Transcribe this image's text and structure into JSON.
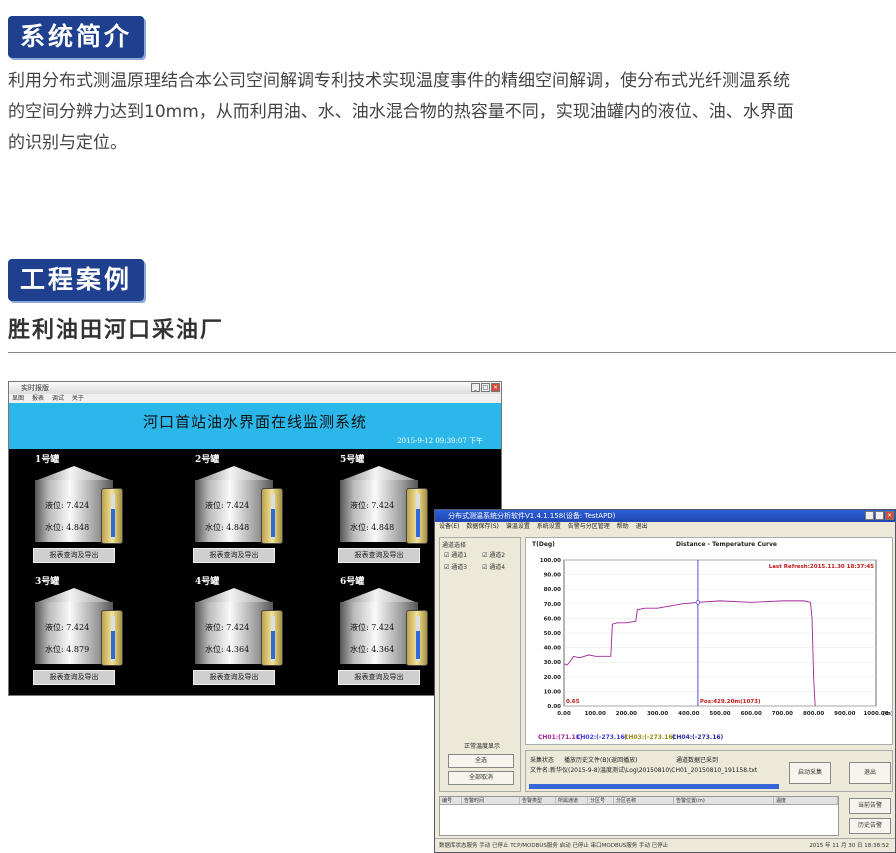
{
  "intro": {
    "badge": "系统简介",
    "text": "利用分布式测温原理结合本公司空间解调专利技术实现温度事件的精细空间解调，使分布式光纤测温系统\n的空间分辨力达到10mm，从而利用油、水、油水混合物的热容量不同，实现油罐内的液位、油、水界面\n的识别与定位。"
  },
  "cases": {
    "badge": "工程案例",
    "subtitle": "胜利油田河口采油厂"
  },
  "monitor_window": {
    "title_bar": "实时报版",
    "menu": [
      "显图",
      "报表",
      "调试",
      "关于"
    ],
    "header_title": "河口首站油水界面在线监测系统",
    "datetime": "2015-9-12  09:39:07 下午",
    "tanks": [
      {
        "name": "1号罐",
        "level_label": "液位",
        "level": "7.424",
        "water_label": "水位",
        "water": "4.848",
        "button": "报表查询及导出"
      },
      {
        "name": "2号罐",
        "level_label": "液位",
        "level": "7.424",
        "water_label": "水位",
        "water": "4.848",
        "button": "报表查询及导出"
      },
      {
        "name": "5号罐",
        "level_label": "液位",
        "level": "7.424",
        "water_label": "水位",
        "water": "4.848",
        "button": "报表查询及导出"
      },
      {
        "name": "3号罐",
        "level_label": "液位",
        "level": "7.424",
        "water_label": "水位",
        "water": "4.879",
        "button": "报表查询及导出"
      },
      {
        "name": "4号罐",
        "level_label": "液位",
        "level": "7.424",
        "water_label": "水位",
        "water": "4.364",
        "button": "报表查询及导出"
      },
      {
        "name": "6号罐",
        "level_label": "液位",
        "level": "7.424",
        "water_label": "水位",
        "water": "4.364",
        "button": "报表查询及导出"
      }
    ]
  },
  "analysis_window": {
    "title_bar": "分布式测温系统分析软件V1.4.1.158(设备: TestAPD)",
    "menu": [
      "设备(E)",
      "数据保存(S)",
      "谱温设置",
      "系统设置",
      "告警与分区管理",
      "帮助",
      "退出"
    ],
    "channel_group": "通道选择",
    "channels": [
      "通道1",
      "通道2",
      "通道3",
      "通道4"
    ],
    "buttons": [
      "正常温度显示",
      "全选",
      "全部取消"
    ],
    "status_labels": [
      "采集状态",
      "播放历史文件(B)(返回播放)",
      "通道数据已采到"
    ],
    "file_label": "文件名:新华仪(2015-9-8)温度测试\\Log\\20150810\\CH01_20150810_191158.txt",
    "start_button": "启动采集",
    "exit_button": "退出",
    "table_headers": [
      "编号",
      "告警时间",
      "告警类型",
      "所属通道",
      "分区号",
      "分区名称",
      "告警位置(m)",
      "温度"
    ],
    "side_buttons": [
      "当前告警",
      "历史告警"
    ],
    "status_bar": "数据库状态服务  手动  已停止    TCP/MODBUS服务  启动  已停止    串口MODBUS服务  手动  已停止",
    "status_time": "2015 年 11 月 30 日   18:38:52"
  },
  "chart_data": {
    "type": "line",
    "title": "Distance - Temperature Curve",
    "ylabel": "T(Deg)",
    "xlabel": "(m)",
    "xlim": [
      0,
      1000
    ],
    "ylim": [
      0,
      100
    ],
    "xticks": [
      "0.00",
      "100.00",
      "200.00",
      "300.00",
      "400.00",
      "500.00",
      "600.00",
      "700.00",
      "800.00",
      "900.00",
      "1000.00"
    ],
    "yticks": [
      "0.00",
      "10.00",
      "20.00",
      "30.00",
      "40.00",
      "50.00",
      "60.00",
      "70.00",
      "80.00",
      "90.00",
      "100.00"
    ],
    "last_refresh": "Last Refresh:2015.11.30 18:37:45",
    "cursor_label": "Pos:429.20m(1073)",
    "cursor_x": 429.2,
    "corner_value": "0.65",
    "channel_readouts": [
      "CH01:(71.11)",
      "CH02:(-273.16)",
      "CH03:(-273.16)",
      "CH04:(-273.16)"
    ],
    "channel_colors": [
      "#a0229a",
      "#3a3adc",
      "#9a8a10",
      "#2a2aa0"
    ],
    "series": [
      {
        "name": "CH01",
        "x": [
          0,
          10,
          25,
          30,
          50,
          80,
          100,
          150,
          155,
          170,
          200,
          230,
          235,
          260,
          300,
          380,
          430,
          500,
          600,
          700,
          770,
          790,
          795,
          800,
          805
        ],
        "y": [
          29,
          28,
          32,
          34,
          33,
          35,
          34,
          34,
          56,
          57,
          57,
          58,
          66,
          67,
          67,
          70,
          71,
          72,
          71,
          72,
          72,
          71,
          60,
          20,
          0
        ]
      }
    ]
  }
}
